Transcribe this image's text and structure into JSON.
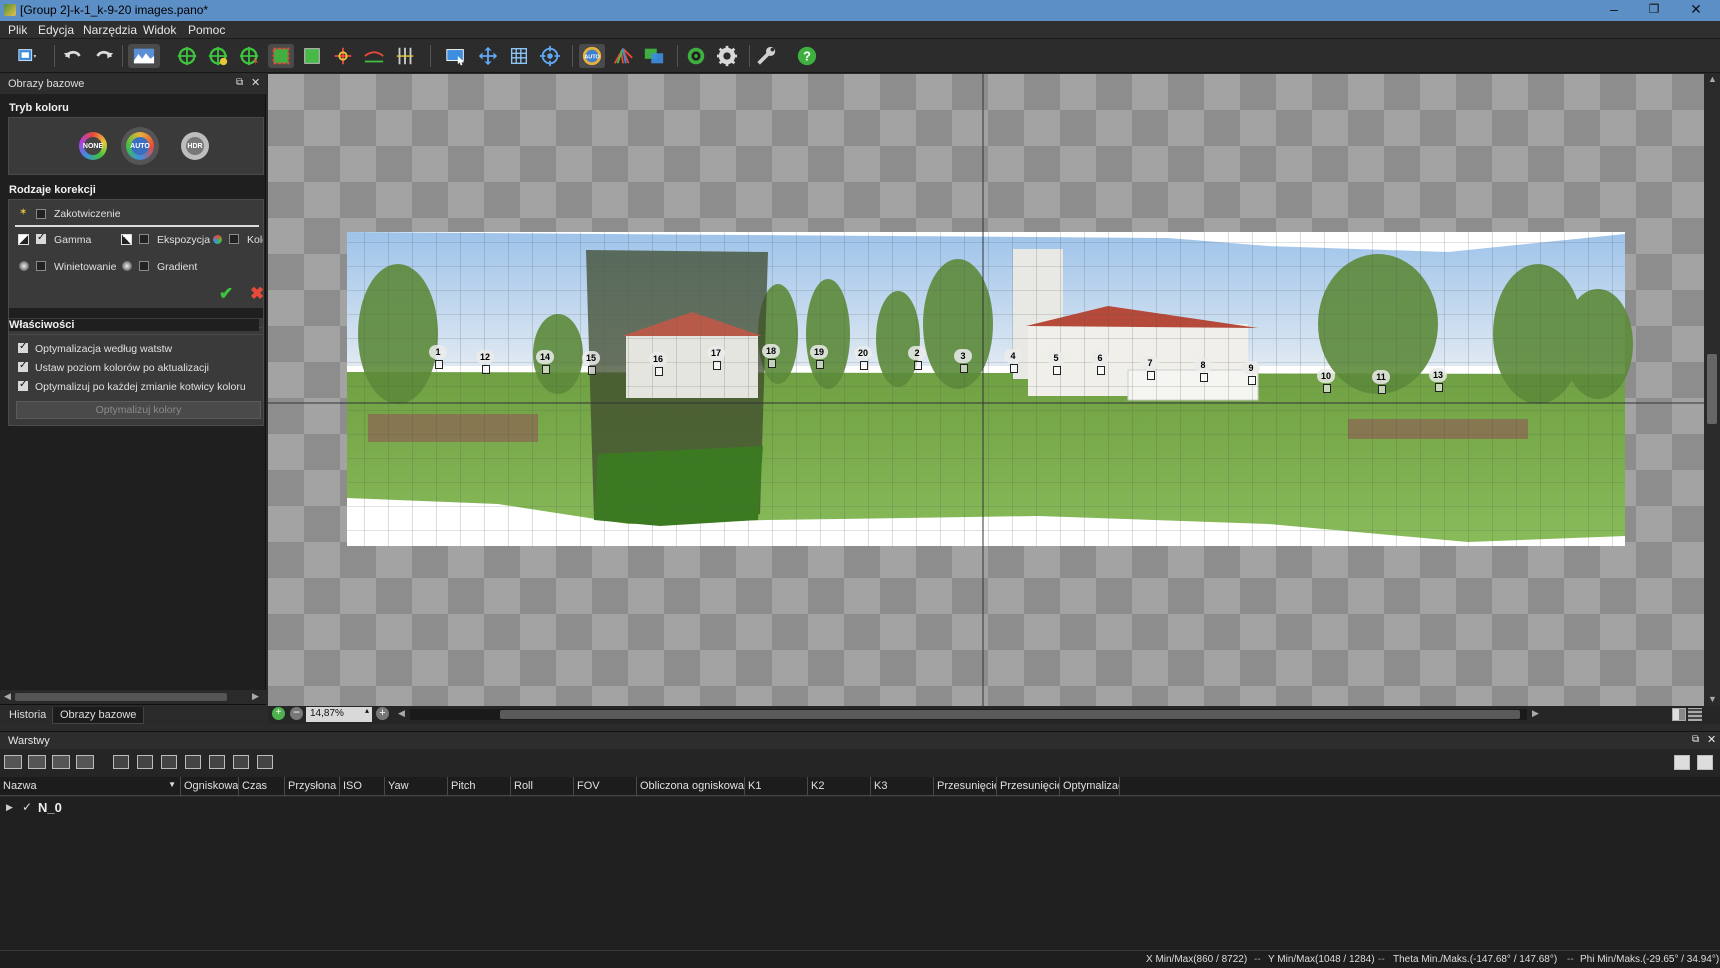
{
  "window": {
    "title": "[Group 2]-k-1_k-9-20 images.pano*",
    "minimize": "–",
    "maximize": "❐",
    "close": "✕"
  },
  "menu": [
    "Plik",
    "Edycja",
    "Narzędzia",
    "Widok",
    "Pomoc"
  ],
  "toolbar_icons": [
    "layout-icon",
    "undo-icon",
    "redo-icon",
    "panorama-icon",
    "control-point-add-icon",
    "control-point-optimize-icon",
    "control-point-move-icon",
    "crop-icon",
    "fit-icon",
    "center-icon",
    "horizon-icon",
    "vertical-lines-icon",
    "preview-icon",
    "move-icon",
    "grid-icon",
    "target-icon",
    "auto-color-icon",
    "color-wheel-icon",
    "blend-icon",
    "stitch-icon",
    "settings-icon",
    "tools-icon",
    "help-icon"
  ],
  "left_panel": {
    "title": "Obrazy bazowe",
    "color_mode_heading": "Tryb koloru",
    "modes": [
      "NONE",
      "AUTO",
      "HDR"
    ],
    "correction_heading": "Rodzaje korekcji",
    "anchor_label": "Zakotwiczenie",
    "gamma_label": "Gamma",
    "exposure_label": "Ekspozycja",
    "color_label": "Kolor",
    "vignetting_label": "Winietowanie",
    "gradient_label": "Gradient",
    "properties_heading": "Właściwości",
    "opt_layers": "Optymalizacja według watstw",
    "opt_level": "Ustaw poziom kolorów po aktualizacji",
    "opt_each": "Optymalizuj po każdej zmianie kotwicy koloru",
    "optimize_button": "Optymalizuj kolory"
  },
  "left_tabs": [
    "Historia",
    "Obrazy bazowe"
  ],
  "zoom": {
    "value": "14,87%"
  },
  "control_points": [
    "1",
    "12",
    "14",
    "15",
    "16",
    "17",
    "18",
    "19",
    "20",
    "2",
    "3",
    "4",
    "5",
    "6",
    "7",
    "8",
    "9",
    "10",
    "11",
    "13"
  ],
  "layers": {
    "title": "Warstwy",
    "columns": [
      "Nazwa",
      "Ogniskowa",
      "Czas",
      "Przysłona",
      "ISO",
      "Yaw",
      "Pitch",
      "Roll",
      "FOV",
      "Obliczona ogniskowa",
      "K1",
      "K2",
      "K3",
      "Przesunięcie",
      "Przesunięcie",
      "Optymalizac"
    ],
    "rows": [
      {
        "name": "N_0"
      }
    ]
  },
  "status": {
    "x": "X Min/Max(860 / 8722)",
    "y": "Y Min/Max(1048 / 1284)",
    "theta": "Theta Min./Maks.(-147.68° / 147.68°)",
    "phi": "Phi Min/Maks.(-29.65° / 34.94°)"
  }
}
